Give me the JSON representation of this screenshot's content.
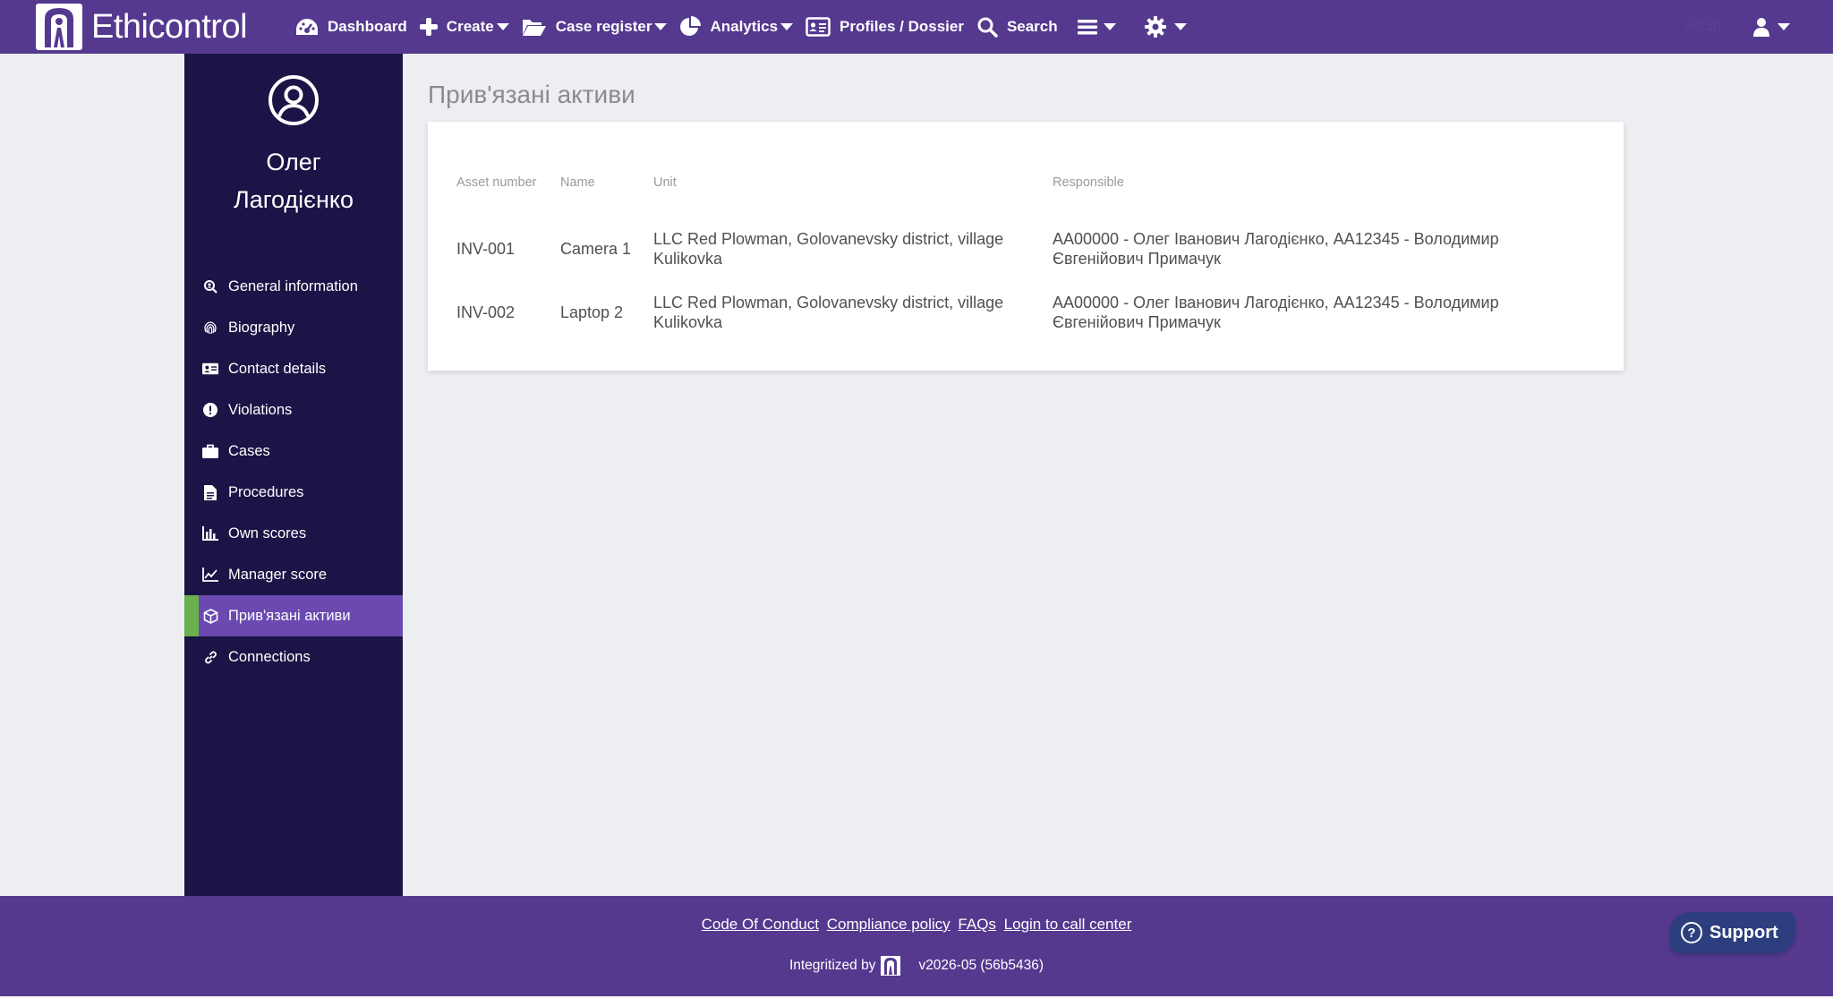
{
  "app": {
    "name": "Ethicontrol"
  },
  "nav": {
    "items": [
      {
        "label": "Dashboard",
        "icon": "dashboard-icon",
        "dropdown": false
      },
      {
        "label": "Create",
        "icon": "plus-icon",
        "dropdown": true
      },
      {
        "label": "Case register",
        "icon": "folder-open-icon",
        "dropdown": true
      },
      {
        "label": "Analytics",
        "icon": "pie-chart-icon",
        "dropdown": true
      },
      {
        "label": "Profiles / Dossier",
        "icon": "id-card-icon",
        "dropdown": false
      },
      {
        "label": "Search",
        "icon": "search-icon",
        "dropdown": false
      }
    ],
    "timer": "58:50"
  },
  "profile": {
    "name_line1": "Олег",
    "name_line2": "Лагодієнко"
  },
  "sidebar": {
    "items": [
      {
        "label": "General information",
        "icon": "general-info-icon"
      },
      {
        "label": "Biography",
        "icon": "fingerprint-icon"
      },
      {
        "label": "Contact details",
        "icon": "address-card-icon"
      },
      {
        "label": "Violations",
        "icon": "exclamation-icon"
      },
      {
        "label": "Cases",
        "icon": "briefcase-icon"
      },
      {
        "label": "Procedures",
        "icon": "document-icon"
      },
      {
        "label": "Own scores",
        "icon": "bar-chart-icon"
      },
      {
        "label": "Manager score",
        "icon": "line-chart-icon"
      },
      {
        "label": "Прив'язані активи",
        "icon": "cube-icon",
        "active": true
      },
      {
        "label": "Connections",
        "icon": "link-icon"
      }
    ]
  },
  "main": {
    "title": "Прив'язані активи",
    "table": {
      "headers": [
        "Asset number",
        "Name",
        "Unit",
        "Responsible"
      ],
      "rows": [
        [
          "INV-001",
          "Camera 1",
          "LLC Red Plowman, Golovanevsky district, village Kulikovka",
          "AA00000 - Олег Іванович Лагодієнко, AA12345 - Володимир Євгенійович Примачук"
        ],
        [
          "INV-002",
          "Laptop 2",
          "LLC Red Plowman, Golovanevsky district, village Kulikovka",
          "AA00000 - Олег Іванович Лагодієнко, AA12345 - Володимир Євгенійович Примачук"
        ]
      ]
    }
  },
  "footer": {
    "links": [
      "Code Of Conduct",
      "Compliance policy",
      "FAQs",
      "Login to call center"
    ],
    "integritized_by": "Integritized by",
    "version": "v2026-05 (56b5436)",
    "support_label": "Support"
  },
  "colors": {
    "navbar": "#54398f",
    "sidebar": "#1b1446",
    "active_item": "#6a4ab1",
    "active_marker": "#6ab04c",
    "support_button": "#2c3e7d"
  }
}
